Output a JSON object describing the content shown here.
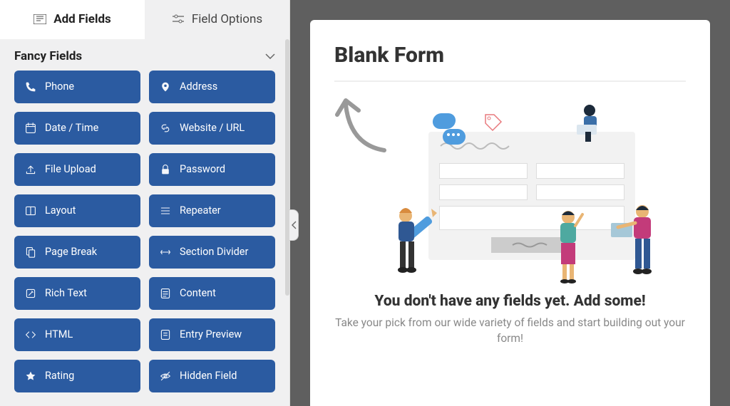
{
  "tabs": {
    "add_fields": "Add Fields",
    "field_options": "Field Options"
  },
  "section": {
    "title": "Fancy Fields"
  },
  "fields": [
    {
      "icon": "phone-icon",
      "label": "Phone"
    },
    {
      "icon": "pin-icon",
      "label": "Address"
    },
    {
      "icon": "calendar-icon",
      "label": "Date / Time"
    },
    {
      "icon": "link-icon",
      "label": "Website / URL"
    },
    {
      "icon": "upload-icon",
      "label": "File Upload"
    },
    {
      "icon": "lock-icon",
      "label": "Password"
    },
    {
      "icon": "layout-icon",
      "label": "Layout"
    },
    {
      "icon": "list-icon",
      "label": "Repeater"
    },
    {
      "icon": "pagebreak-icon",
      "label": "Page Break"
    },
    {
      "icon": "divider-icon",
      "label": "Section Divider"
    },
    {
      "icon": "richtext-icon",
      "label": "Rich Text"
    },
    {
      "icon": "content-icon",
      "label": "Content"
    },
    {
      "icon": "code-icon",
      "label": "HTML"
    },
    {
      "icon": "preview-icon",
      "label": "Entry Preview"
    },
    {
      "icon": "star-icon",
      "label": "Rating"
    },
    {
      "icon": "hidden-icon",
      "label": "Hidden Field"
    }
  ],
  "form": {
    "title": "Blank Form",
    "empty_headline": "You don't have any fields yet. Add some!",
    "empty_subline": "Take your pick from our wide variety of fields and start building out your form!"
  }
}
